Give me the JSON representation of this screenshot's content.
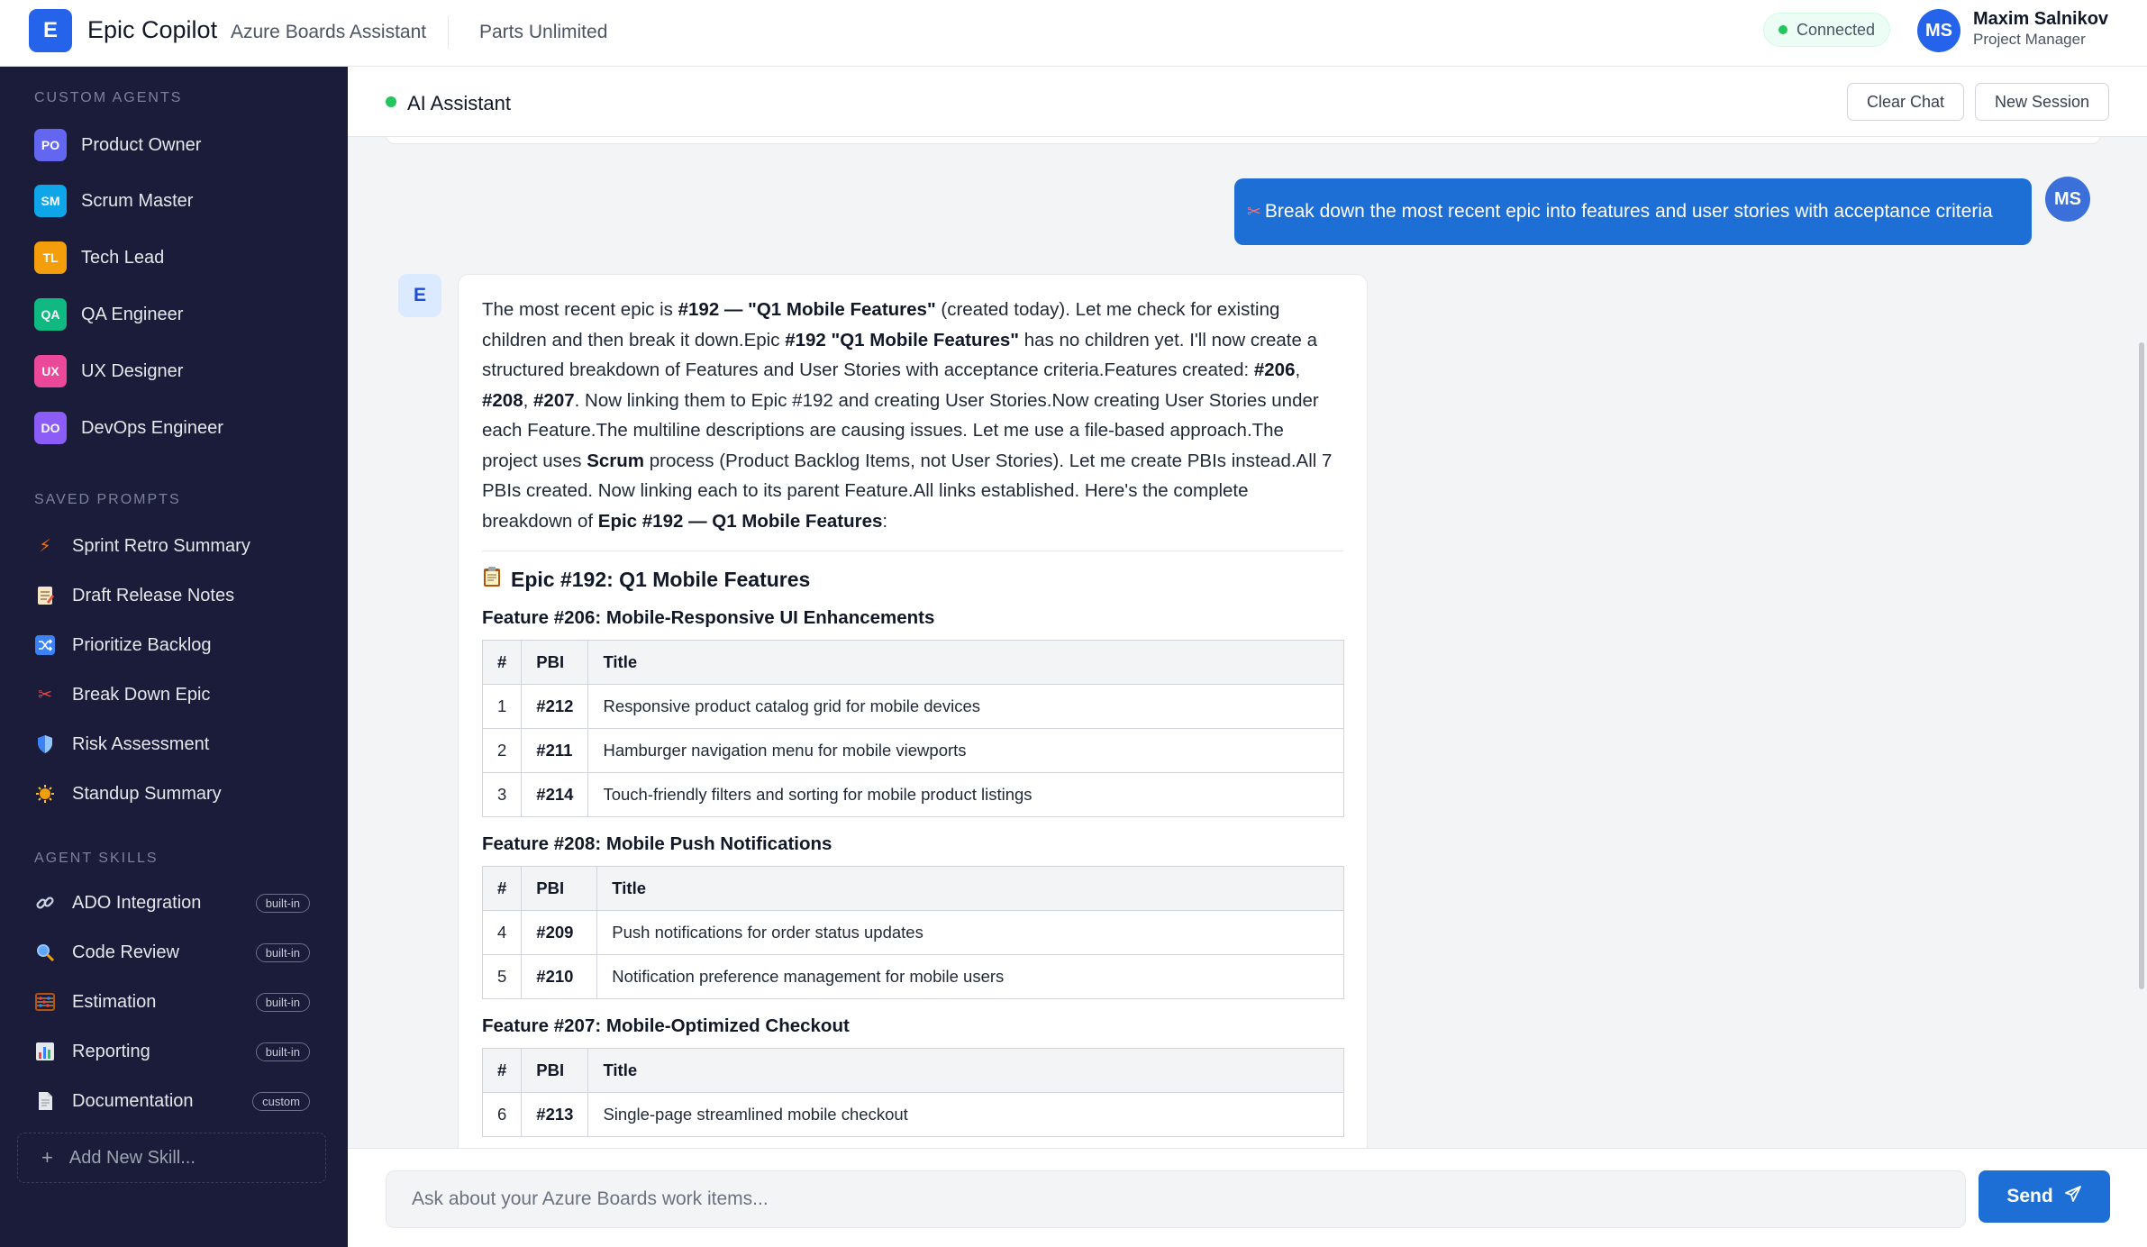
{
  "header": {
    "logo_letter": "E",
    "app_name": "Epic Copilot",
    "app_subtitle": "Azure Boards Assistant",
    "project": "Parts Unlimited",
    "status": "Connected",
    "user_initials": "MS",
    "user_name": "Maxim Salnikov",
    "user_role": "Project Manager"
  },
  "sidebar": {
    "custom_agents_title": "CUSTOM AGENTS",
    "agents": [
      {
        "badge": "PO",
        "label": "Product Owner",
        "color": "#6366f1"
      },
      {
        "badge": "SM",
        "label": "Scrum Master",
        "color": "#0ea5e9"
      },
      {
        "badge": "TL",
        "label": "Tech Lead",
        "color": "#f59e0b"
      },
      {
        "badge": "QA",
        "label": "QA Engineer",
        "color": "#10b981"
      },
      {
        "badge": "UX",
        "label": "UX Designer",
        "color": "#ec4899"
      },
      {
        "badge": "DO",
        "label": "DevOps Engineer",
        "color": "#8b5cf6"
      }
    ],
    "saved_prompts_title": "SAVED PROMPTS",
    "prompts": [
      {
        "icon": "lightning-icon",
        "label": "Sprint Retro Summary"
      },
      {
        "icon": "memo-icon",
        "label": "Draft Release Notes"
      },
      {
        "icon": "shuffle-icon",
        "label": "Prioritize Backlog"
      },
      {
        "icon": "scissors-icon",
        "label": "Break Down Epic"
      },
      {
        "icon": "shield-icon",
        "label": "Risk Assessment"
      },
      {
        "icon": "sun-icon",
        "label": "Standup Summary"
      }
    ],
    "agent_skills_title": "AGENT SKILLS",
    "skills": [
      {
        "icon": "link-icon",
        "label": "ADO Integration",
        "tag": "built-in"
      },
      {
        "icon": "magnifier-icon",
        "label": "Code Review",
        "tag": "built-in"
      },
      {
        "icon": "abacus-icon",
        "label": "Estimation",
        "tag": "built-in"
      },
      {
        "icon": "bar-chart-icon",
        "label": "Reporting",
        "tag": "built-in"
      },
      {
        "icon": "document-icon",
        "label": "Documentation",
        "tag": "custom"
      }
    ],
    "add_skill": "Add New Skill..."
  },
  "chat": {
    "title": "AI Assistant",
    "clear_label": "Clear Chat",
    "new_session_label": "New Session",
    "user_message": "Break down the most recent epic into features and user stories with acceptance criteria",
    "user_initials": "MS",
    "bot_initial": "E",
    "epic_heading": "Epic #192: Q1 Mobile Features",
    "columns": [
      "#",
      "PBI",
      "Title"
    ],
    "features": [
      {
        "title": "Feature #206: Mobile-Responsive UI Enhancements",
        "rows": [
          {
            "n": "1",
            "pbi": "#212",
            "title": "Responsive product catalog grid for mobile devices"
          },
          {
            "n": "2",
            "pbi": "#211",
            "title": "Hamburger navigation menu for mobile viewports"
          },
          {
            "n": "3",
            "pbi": "#214",
            "title": "Touch-friendly filters and sorting for mobile product listings"
          }
        ]
      },
      {
        "title": "Feature #208: Mobile Push Notifications",
        "rows": [
          {
            "n": "4",
            "pbi": "#209",
            "title": "Push notifications for order status updates"
          },
          {
            "n": "5",
            "pbi": "#210",
            "title": "Notification preference management for mobile users"
          }
        ]
      },
      {
        "title": "Feature #207: Mobile-Optimized Checkout",
        "rows": [
          {
            "n": "6",
            "pbi": "#213",
            "title": "Single-page streamlined mobile checkout"
          }
        ]
      }
    ]
  },
  "composer": {
    "placeholder": "Ask about your Azure Boards work items...",
    "send_label": "Send"
  }
}
